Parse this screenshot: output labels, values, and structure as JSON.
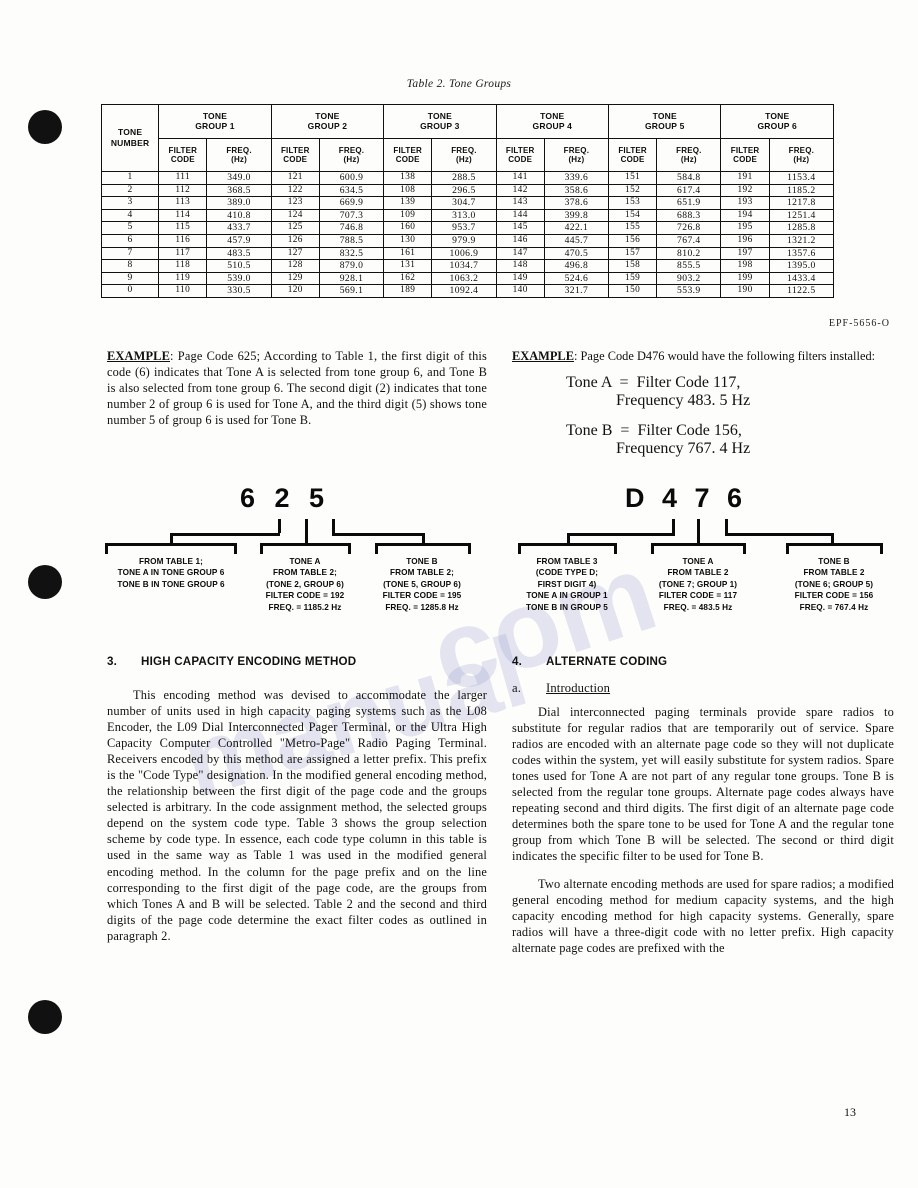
{
  "page": {
    "number": "13",
    "figure_ref": "EPF-5656-O"
  },
  "table": {
    "caption": "Table 2.  Tone Groups",
    "row_header": {
      "line1": "TONE",
      "line2": "NUMBER"
    },
    "group_headers": [
      {
        "line1": "TONE",
        "line2": "GROUP 1"
      },
      {
        "line1": "TONE",
        "line2": "GROUP 2"
      },
      {
        "line1": "TONE",
        "line2": "GROUP 3"
      },
      {
        "line1": "TONE",
        "line2": "GROUP 4"
      },
      {
        "line1": "TONE",
        "line2": "GROUP 5"
      },
      {
        "line1": "TONE",
        "line2": "GROUP 6"
      }
    ],
    "sub_headers": {
      "filter_code": {
        "line1": "FILTER",
        "line2": "CODE"
      },
      "freq": {
        "line1": "FREQ.",
        "line2": "(Hz)"
      }
    },
    "rows": [
      {
        "tone": "1",
        "cells": [
          [
            "111",
            "349.0"
          ],
          [
            "121",
            "600.9"
          ],
          [
            "138",
            "288.5"
          ],
          [
            "141",
            "339.6"
          ],
          [
            "151",
            "584.8"
          ],
          [
            "191",
            "1153.4"
          ]
        ]
      },
      {
        "tone": "2",
        "cells": [
          [
            "112",
            "368.5"
          ],
          [
            "122",
            "634.5"
          ],
          [
            "108",
            "296.5"
          ],
          [
            "142",
            "358.6"
          ],
          [
            "152",
            "617.4"
          ],
          [
            "192",
            "1185.2"
          ]
        ]
      },
      {
        "tone": "3",
        "cells": [
          [
            "113",
            "389.0"
          ],
          [
            "123",
            "669.9"
          ],
          [
            "139",
            "304.7"
          ],
          [
            "143",
            "378.6"
          ],
          [
            "153",
            "651.9"
          ],
          [
            "193",
            "1217.8"
          ]
        ]
      },
      {
        "tone": "4",
        "cells": [
          [
            "114",
            "410.8"
          ],
          [
            "124",
            "707.3"
          ],
          [
            "109",
            "313.0"
          ],
          [
            "144",
            "399.8"
          ],
          [
            "154",
            "688.3"
          ],
          [
            "194",
            "1251.4"
          ]
        ]
      },
      {
        "tone": "5",
        "cells": [
          [
            "115",
            "433.7"
          ],
          [
            "125",
            "746.8"
          ],
          [
            "160",
            "953.7"
          ],
          [
            "145",
            "422.1"
          ],
          [
            "155",
            "726.8"
          ],
          [
            "195",
            "1285.8"
          ]
        ]
      },
      {
        "tone": "6",
        "cells": [
          [
            "116",
            "457.9"
          ],
          [
            "126",
            "788.5"
          ],
          [
            "130",
            "979.9"
          ],
          [
            "146",
            "445.7"
          ],
          [
            "156",
            "767.4"
          ],
          [
            "196",
            "1321.2"
          ]
        ]
      },
      {
        "tone": "7",
        "cells": [
          [
            "117",
            "483.5"
          ],
          [
            "127",
            "832.5"
          ],
          [
            "161",
            "1006.9"
          ],
          [
            "147",
            "470.5"
          ],
          [
            "157",
            "810.2"
          ],
          [
            "197",
            "1357.6"
          ]
        ]
      },
      {
        "tone": "8",
        "cells": [
          [
            "118",
            "510.5"
          ],
          [
            "128",
            "879.0"
          ],
          [
            "131",
            "1034.7"
          ],
          [
            "148",
            "496.8"
          ],
          [
            "158",
            "855.5"
          ],
          [
            "198",
            "1395.0"
          ]
        ]
      },
      {
        "tone": "9",
        "cells": [
          [
            "119",
            "539.0"
          ],
          [
            "129",
            "928.1"
          ],
          [
            "162",
            "1063.2"
          ],
          [
            "149",
            "524.6"
          ],
          [
            "159",
            "903.2"
          ],
          [
            "199",
            "1433.4"
          ]
        ]
      },
      {
        "tone": "0",
        "cells": [
          [
            "110",
            "330.5"
          ],
          [
            "120",
            "569.1"
          ],
          [
            "189",
            "1092.4"
          ],
          [
            "140",
            "321.7"
          ],
          [
            "150",
            "553.9"
          ],
          [
            "190",
            "1122.5"
          ]
        ]
      }
    ]
  },
  "example_left": {
    "label": "EXAMPLE",
    "text": ": Page Code 625; According to Table 1, the first digit of this code (6) indicates that Tone A is selected from tone group 6, and Tone B is also selected from tone group 6.  The second digit (2) indicates that tone number 2 of group 6 is used for Tone A, and the third digit (5) shows tone number 5 of group 6 is used for Tone B."
  },
  "example_right": {
    "label": "EXAMPLE",
    "text": ":  Page Code D476 would have the following filters installed:",
    "lines": [
      "Tone A  =  Filter Code 117,",
      "Frequency 483. 5 Hz",
      "Tone B  =  Filter Code 156,",
      "Frequency 767. 4 Hz"
    ]
  },
  "diagram_left": {
    "code": "6 2 5",
    "captions": [
      [
        "FROM TABLE 1;",
        "TONE A IN TONE GROUP 6",
        "TONE B IN TONE GROUP 6"
      ],
      [
        "TONE A",
        "FROM TABLE 2;",
        "(TONE 2, GROUP 6)",
        "FILTER CODE = 192",
        "FREQ. = 1185.2 Hz"
      ],
      [
        "TONE B",
        "FROM TABLE 2;",
        "(TONE 5, GROUP 6)",
        "FILTER CODE = 195",
        "FREQ. = 1285.8 Hz"
      ]
    ]
  },
  "diagram_right": {
    "code": "D 4 7 6",
    "captions": [
      [
        "FROM TABLE 3",
        "(CODE TYPE D;",
        "FIRST DIGIT 4)",
        "TONE A IN GROUP 1",
        "TONE B IN GROUP 5"
      ],
      [
        "TONE A",
        "FROM TABLE 2",
        "(TONE 7; GROUP 1)",
        "FILTER CODE = 117",
        "FREQ. = 483.5 Hz"
      ],
      [
        "TONE B",
        "FROM TABLE 2",
        "(TONE 6; GROUP 5)",
        "FILTER CODE = 156",
        "FREQ. = 767.4 Hz"
      ]
    ]
  },
  "section3": {
    "number": "3.",
    "title": "HIGH CAPACITY ENCODING METHOD",
    "paragraph": "This encoding method was devised to accommodate the larger number of units used in high capacity paging systems such as the L08 Encoder, the L09 Dial Interconnected Pager Terminal, or the Ultra High Capacity Computer Controlled \"Metro-Page\" Radio Paging Terminal. Receivers encoded by this method are assigned a letter prefix.   This prefix is the \"Code Type\" designation.   In the modified general encoding method, the relationship between the first digit of the page code and the groups selected is arbitrary.   In the code assignment method, the selected groups depend on the system code type.   Table 3 shows the group selection scheme by code type.   In essence, each code type column in this table is used in the same way as Table 1 was used in the modified general encoding method.  In the column for the page prefix and on the line corresponding to the first digit of the page code, are the groups from which Tones A and B will be selected. Table 2 and the second and third digits of the page code determine the exact filter codes as outlined in paragraph 2."
  },
  "section4": {
    "number": "4.",
    "title": "ALTERNATE CODING",
    "sub_letter": "a.",
    "sub_title": "Introduction",
    "paragraph1": "Dial interconnected paging terminals provide spare radios to substitute for regular radios that are temporarily out of service.   Spare radios are encoded with an alternate page code so they will not duplicate codes within the system,   yet will easily substitute for system radios.   Spare tones used for Tone A are not part of any regular tone groups.   Tone B is selected from the regular tone groups.   Alternate page codes always have repeating second and third digits.  The first digit of an alternate page code determines both the spare tone to be used for Tone A and the regular tone group from which Tone B will be selected. The second or third digit indicates the specific filter to be used for Tone B.",
    "paragraph2": "Two alternate encoding methods are used for spare radios; a modified general encoding method for medium capacity systems, and the high capacity encoding method for high capacity systems. Generally, spare radios will have a three-digit code with no letter prefix. High capacity alternate page codes are prefixed with the"
  }
}
